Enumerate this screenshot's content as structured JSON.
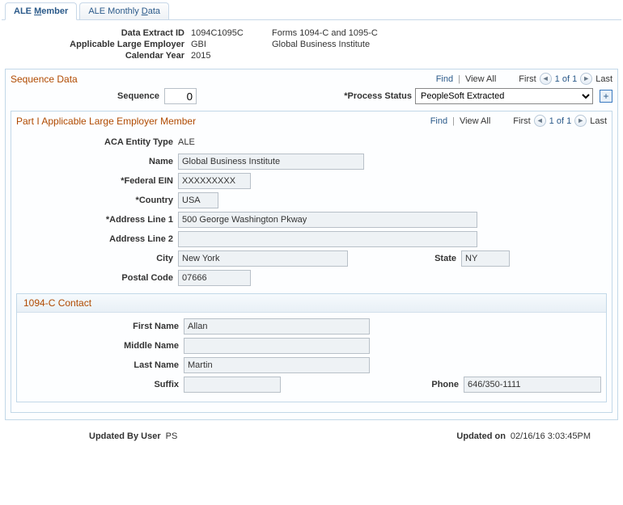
{
  "tabs": {
    "member_pre": "ALE ",
    "member_u": "M",
    "member_post": "ember",
    "monthly_pre": "ALE Monthly ",
    "monthly_u": "D",
    "monthly_post": "ata"
  },
  "header": {
    "labels": {
      "extract": "Data Extract ID",
      "ale": "Applicable Large Employer",
      "year": "Calendar Year"
    },
    "extract_id": "1094C1095C",
    "extract_desc": "Forms 1094-C and 1095-C",
    "ale_code": "GBI",
    "ale_desc": "Global Business Institute",
    "year": "2015"
  },
  "scroll": {
    "find": "Find",
    "viewall": "View All",
    "first": "First",
    "counter": "1 of 1",
    "last": "Last"
  },
  "seq": {
    "title": "Sequence Data",
    "seq_label": "Sequence",
    "seq_value": "0",
    "status_label": "*Process Status",
    "status_value": "PeopleSoft Extracted"
  },
  "part1": {
    "title": "Part I Applicable Large Employer Member",
    "labels": {
      "entity": "ACA Entity Type",
      "name": "Name",
      "ein": "*Federal EIN",
      "country": "*Country",
      "addr1": "*Address Line 1",
      "addr2": "Address Line 2",
      "city": "City",
      "state": "State",
      "postal": "Postal Code"
    },
    "entity": "ALE",
    "name": "Global Business Institute",
    "ein": "XXXXXXXXX",
    "country": "USA",
    "addr1": "500 George Washington Pkway",
    "addr2": "",
    "city": "New York",
    "state": "NY",
    "postal": "07666"
  },
  "contact": {
    "title": "1094-C Contact",
    "labels": {
      "first": "First Name",
      "middle": "Middle Name",
      "last": "Last Name",
      "suffix": "Suffix",
      "phone": "Phone"
    },
    "first": "Allan",
    "middle": "",
    "last": "Martin",
    "suffix": "",
    "phone": "646/350-1111"
  },
  "footer": {
    "by_label": "Updated By User",
    "by": "PS",
    "on_label": "Updated on",
    "on": "02/16/16  3:03:45PM"
  }
}
